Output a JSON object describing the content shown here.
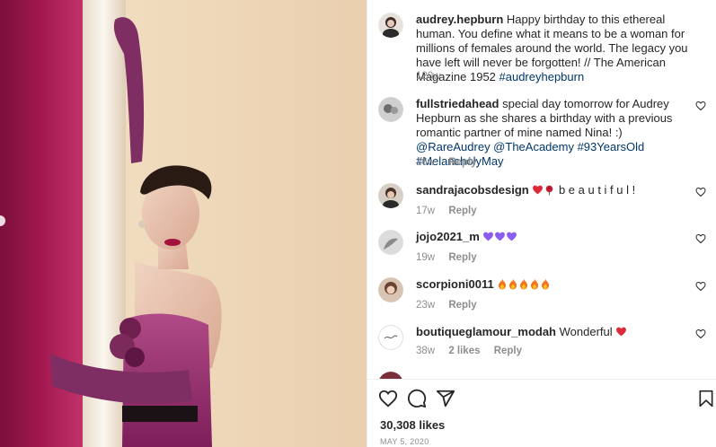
{
  "post": {
    "likes": "30,308 likes",
    "date": "MAY 5, 2020"
  },
  "caption": {
    "username": "audrey.hepburn",
    "text": "Happy birthday to this ethereal human. You define what it means to be a woman for millions of females around the world. The legacy you have left will never be forgotten! // The American Magazine 1952 ",
    "hashtag": "#audreyhepburn",
    "time": "120w"
  },
  "comments": [
    {
      "username": "fullstriedahead",
      "text": "special day tomorrow for Audrey Hepburn as she shares a birthday with a previous romantic partner of mine named Nina! :) ",
      "links": "@RareAudrey @TheAcademy #93YearsOld #MelancholyMay",
      "time": "16w",
      "reply": "Reply"
    },
    {
      "username": "sandrajacobsdesign",
      "text": " b e a u t i f u l !",
      "emojis": [
        "red-heart",
        "red-rose"
      ],
      "time": "17w",
      "reply": "Reply"
    },
    {
      "username": "jojo2021_m",
      "text": "",
      "emojis": [
        "purple-heart",
        "purple-heart",
        "purple-heart"
      ],
      "time": "19w",
      "reply": "Reply"
    },
    {
      "username": "scorpioni0011",
      "text": "",
      "emojis": [
        "fire",
        "fire",
        "fire",
        "fire",
        "fire"
      ],
      "time": "23w",
      "reply": "Reply"
    },
    {
      "username": "boutiqueglamour_modah",
      "text": "Wonderful ",
      "emojis": [
        "red-heart"
      ],
      "time": "38w",
      "likes": "2 likes",
      "reply": "Reply"
    }
  ],
  "icons": {
    "like": "heart-outline-icon",
    "comment": "speech-bubble-icon",
    "share": "paper-plane-icon",
    "save": "bookmark-icon",
    "comment_like": "small-heart-icon"
  },
  "colors": {
    "link": "#00376b",
    "meta": "#8e8e8e",
    "text": "#262626"
  }
}
